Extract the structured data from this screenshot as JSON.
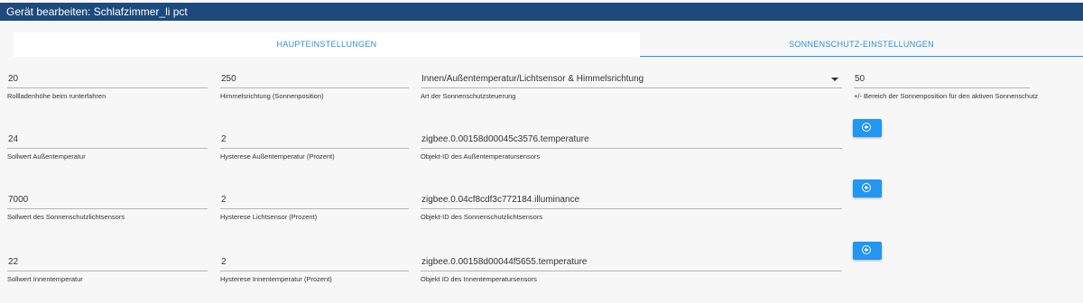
{
  "dialog": {
    "title": "Gerät bearbeiten: Schlafzimmer_li pct"
  },
  "tabs": [
    {
      "label": "HAUPTEINSTELLUNGEN"
    },
    {
      "label": "SONNENSCHUTZ-EINSTELLUNGEN"
    }
  ],
  "rows": [
    {
      "fields": [
        {
          "value": "20",
          "label": "Rollladenhöhe beim runterfahren"
        },
        {
          "value": "250",
          "label": "Himmelsrichtung (Sonnenposition)"
        },
        {
          "value": "Innen/Außentemperatur/Lichtsensor & Himmelsrichtung",
          "label": "Art der Sonnenschutzsteuerung"
        },
        {
          "value": "50",
          "label": "+/- Bereich der Sonnenposition für den aktiven Sonnenschutz"
        }
      ]
    },
    {
      "fields": [
        {
          "value": "24",
          "label": "Sollwert Außentemperatur"
        },
        {
          "value": "2",
          "label": "Hysterese Außentemperatur (Prozent)"
        },
        {
          "value": "zigbee.0.00158d00045c3576.temperature",
          "label": "Objekt-ID des Außentemperatursensors"
        }
      ]
    },
    {
      "fields": [
        {
          "value": "7000",
          "label": "Sollwert des Sonnenschutzlichtsensors"
        },
        {
          "value": "2",
          "label": "Hysterese Lichtsensor (Prozent)"
        },
        {
          "value": "zigbee.0.04cf8cdf3c772184.illuminance",
          "label": "Objekt-ID des Sonnenschutzlichtsensors"
        }
      ]
    },
    {
      "fields": [
        {
          "value": "22",
          "label": "Sollwert Innentemperatur"
        },
        {
          "value": "2",
          "label": "Hysterese Innentemperatur (Prozent)"
        },
        {
          "value": "zigbee.0.00158d00044f5655.temperature",
          "label": "Objekt ID des Innentemperatursensors"
        }
      ]
    }
  ],
  "buttons": {
    "add_icon": "plus-circle-icon"
  },
  "colors": {
    "header": "#1d4a7c",
    "accent": "#2196f3",
    "tab_text": "#2b90d9"
  }
}
